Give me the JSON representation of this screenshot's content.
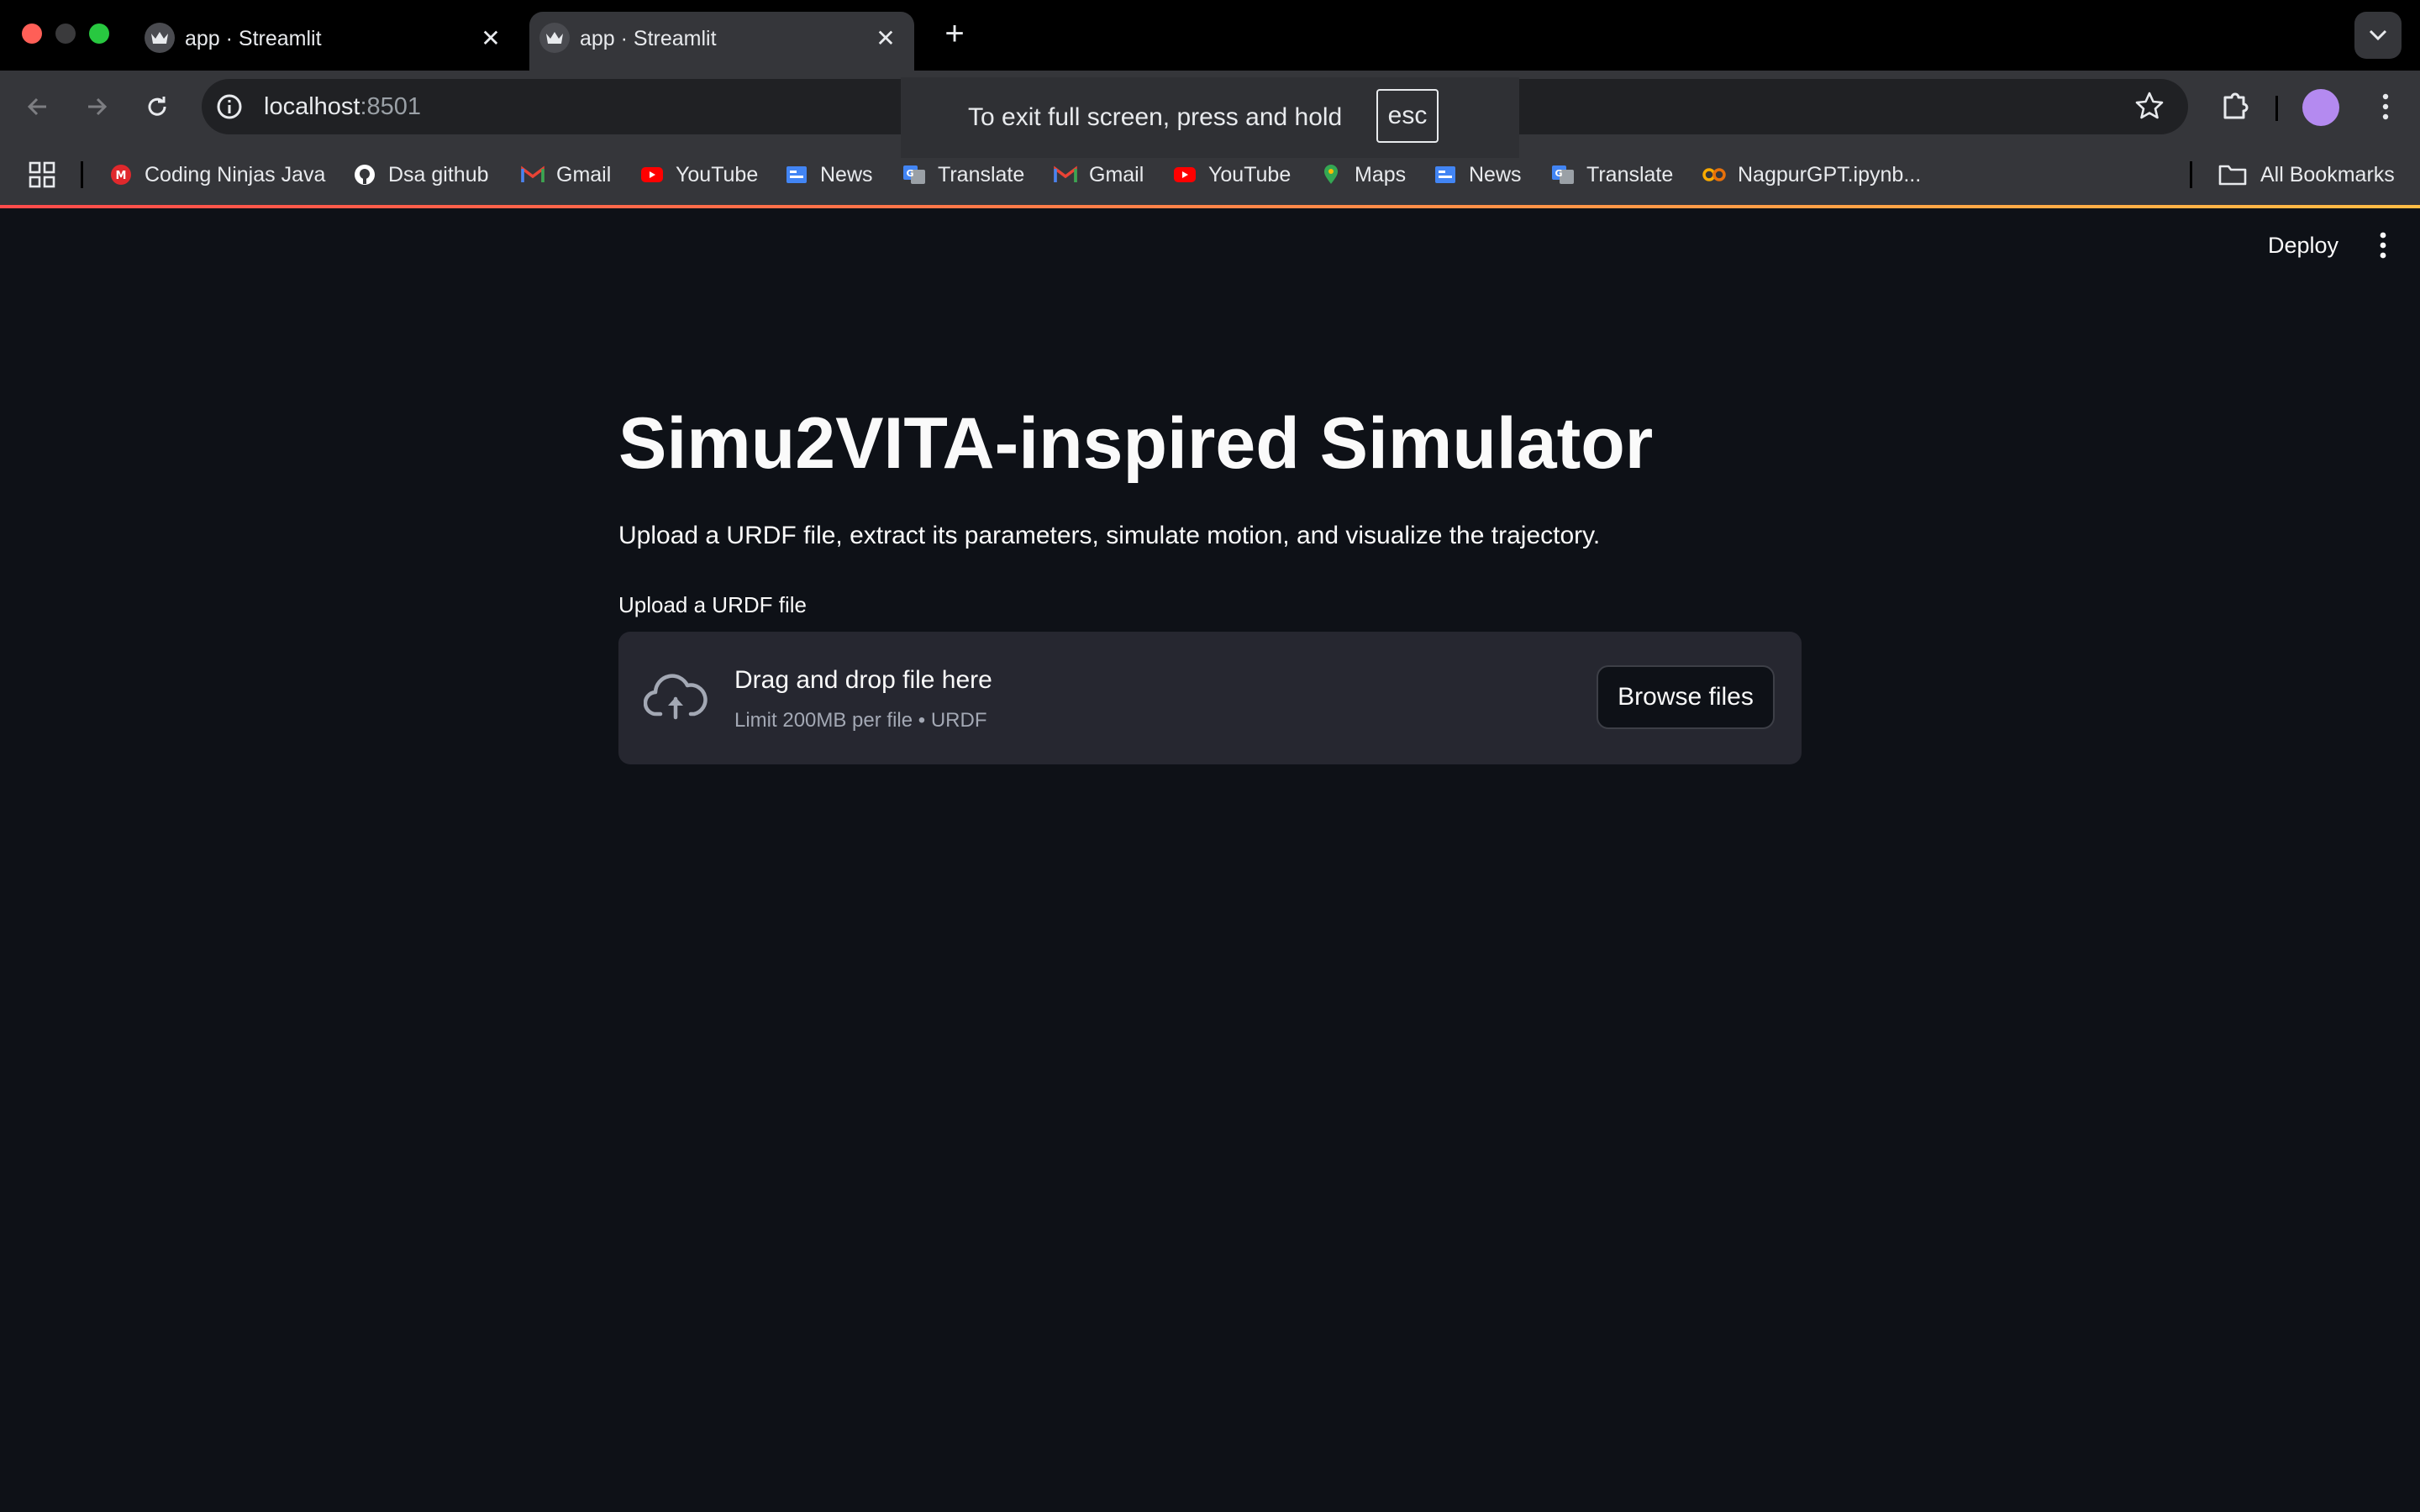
{
  "browser": {
    "tabs": [
      {
        "title": "app · Streamlit",
        "active": false
      },
      {
        "title": "app · Streamlit",
        "active": true
      }
    ],
    "new_tab_symbol": "+",
    "close_symbol": "✕",
    "url_host": "localhost",
    "url_port": ":8501",
    "fullscreen_toast": {
      "message": "To exit full screen, press and hold",
      "key": "esc"
    },
    "bookmarks": [
      {
        "label": "Coding Ninjas Java",
        "icon": "coding-ninjas-icon",
        "color": "#e0282c"
      },
      {
        "label": "Dsa github",
        "icon": "github-icon",
        "color": "#ffffff"
      },
      {
        "label": "Gmail",
        "icon": "gmail-icon",
        "color": "#ea4335"
      },
      {
        "label": "YouTube",
        "icon": "youtube-icon",
        "color": "#ff0000"
      },
      {
        "label": "News",
        "icon": "google-news-icon",
        "color": "#4285f4"
      },
      {
        "label": "Translate",
        "icon": "google-translate-icon",
        "color": "#4285f4"
      },
      {
        "label": "Gmail",
        "icon": "gmail-icon",
        "color": "#ea4335"
      },
      {
        "label": "YouTube",
        "icon": "youtube-icon",
        "color": "#ff0000"
      },
      {
        "label": "Maps",
        "icon": "google-maps-icon",
        "color": "#34a853"
      },
      {
        "label": "News",
        "icon": "google-news-icon",
        "color": "#4285f4"
      },
      {
        "label": "Translate",
        "icon": "google-translate-icon",
        "color": "#4285f4"
      },
      {
        "label": "NagpurGPT.ipynb...",
        "icon": "colab-icon",
        "color": "#f9ab00"
      }
    ],
    "all_bookmarks_label": "All Bookmarks"
  },
  "app": {
    "deploy_label": "Deploy",
    "title": "Simu2VITA-inspired Simulator",
    "subtitle": "Upload a URDF file, extract its parameters, simulate motion, and visualize the trajectory.",
    "uploader": {
      "label": "Upload a URDF file",
      "drop_text": "Drag and drop file here",
      "limit_text": "Limit 200MB per file • URDF",
      "button_label": "Browse files"
    }
  },
  "colors": {
    "background": "#0e1117",
    "dropzone": "#262730",
    "accent_gradient_start": "#ff4b4b",
    "accent_gradient_end": "#ffbd45"
  }
}
